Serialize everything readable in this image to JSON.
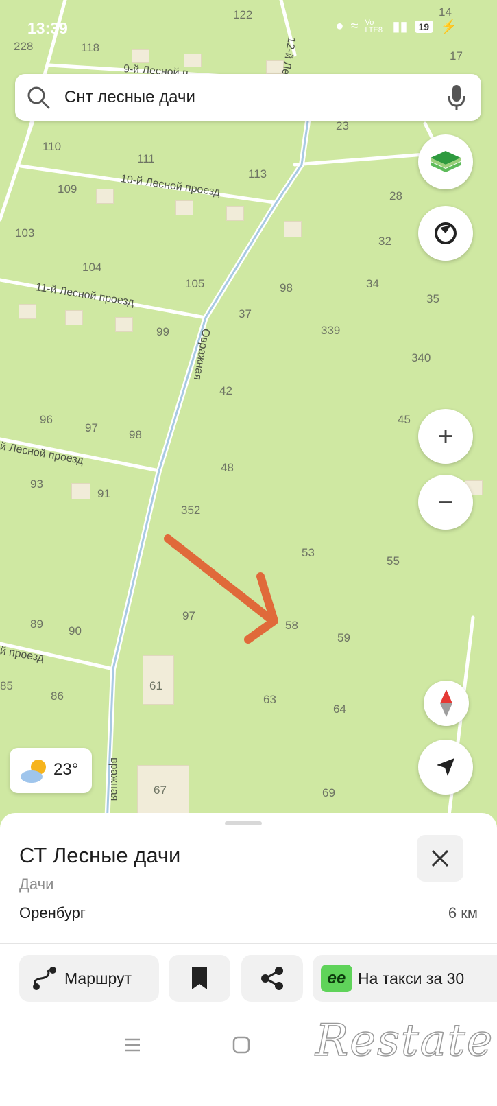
{
  "status_bar": {
    "time": "13:39",
    "network": "Vo LTE8",
    "battery": "19"
  },
  "search": {
    "query": "Снт лесные дачи"
  },
  "map": {
    "streets": [
      "10-й Лесной проезд",
      "11-й Лесной проезд",
      "й Лесной проезд",
      "й проезд",
      "Овражная",
      "вражная",
      "12-й Лесн",
      "9-й Лесной п"
    ],
    "house_numbers": [
      "122",
      "228",
      "118",
      "17",
      "14",
      "23",
      "110",
      "111",
      "113",
      "28",
      "109",
      "103",
      "32",
      "104",
      "34",
      "105",
      "98",
      "35",
      "37",
      "99",
      "339",
      "340",
      "42",
      "96",
      "97",
      "98",
      "45",
      "48",
      "93",
      "91",
      "352",
      "53",
      "55",
      "97",
      "58",
      "59",
      "89",
      "90",
      "85",
      "86",
      "61",
      "63",
      "64",
      "67",
      "69"
    ],
    "road_color": "#ffffff",
    "land_color": "#cfe8a2",
    "arrow_color": "#e06a3a"
  },
  "controls": {
    "layers_icon": "layers-icon",
    "compass_icon": "compass-icon",
    "zoom_in": "+",
    "zoom_out": "−",
    "north_icon": "north-arrow-icon",
    "locate_icon": "locate-icon"
  },
  "weather": {
    "temperature": "23°"
  },
  "place": {
    "title": "СТ Лесные дачи",
    "category": "Дачи",
    "city": "Оренбург",
    "distance": "6 км"
  },
  "actions": {
    "route": "Маршрут",
    "taxi": "На такси за 30"
  },
  "watermark": "Restate"
}
